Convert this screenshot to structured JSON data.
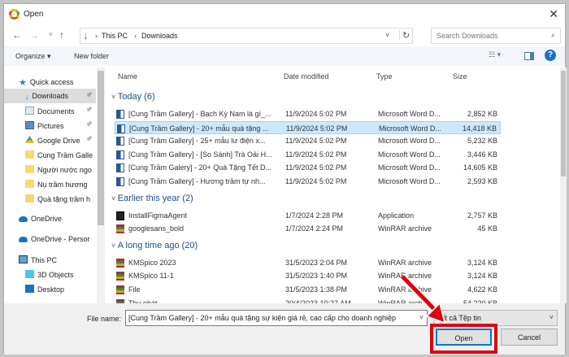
{
  "window": {
    "title": "Open"
  },
  "nav": {
    "path": [
      "This PC",
      "Downloads"
    ],
    "search_placeholder": "Search Downloads"
  },
  "toolbar": {
    "organize": "Organize ▾",
    "new_folder": "New folder"
  },
  "sidebar": {
    "items": [
      {
        "label": "Quick access",
        "icon": "star-icon",
        "indent": 0
      },
      {
        "label": "Downloads",
        "icon": "download-icon",
        "indent": 1,
        "selected": true,
        "pinned": true
      },
      {
        "label": "Documents",
        "icon": "document-icon",
        "indent": 1,
        "pinned": true
      },
      {
        "label": "Pictures",
        "icon": "pictures-icon",
        "indent": 1,
        "pinned": true
      },
      {
        "label": "Google Drive",
        "icon": "google-drive-icon",
        "indent": 1,
        "pinned": true
      },
      {
        "label": "Cung Trầm Galle",
        "icon": "folder-icon",
        "indent": 1
      },
      {
        "label": "Người nước ngo",
        "icon": "folder-icon",
        "indent": 1
      },
      {
        "label": "Nụ trầm hương",
        "icon": "folder-icon",
        "indent": 1
      },
      {
        "label": "Quà tặng trầm h",
        "icon": "folder-icon",
        "indent": 1
      },
      {
        "label": "OneDrive",
        "icon": "cloud-icon",
        "indent": 0
      },
      {
        "label": "OneDrive - Persor",
        "icon": "cloud-icon",
        "indent": 0
      },
      {
        "label": "This PC",
        "icon": "computer-icon",
        "indent": 0
      },
      {
        "label": "3D Objects",
        "icon": "cube-icon",
        "indent": 1
      },
      {
        "label": "Desktop",
        "icon": "desktop-icon",
        "indent": 1
      }
    ]
  },
  "columns": {
    "name": "Name",
    "date": "Date modified",
    "type": "Type",
    "size": "Size"
  },
  "groups": [
    {
      "label": "Today (6)",
      "files": [
        {
          "name": "[Cung Trầm Gallery] - Bạch Kỳ Nam là gì_...",
          "date": "11/9/2024 5:02 PM",
          "type": "Microsoft Word D...",
          "size": "2,852 KB",
          "icon": "word-icon"
        },
        {
          "name": "[Cung Trầm Gallery] - 20+ mẫu quà tặng ...",
          "date": "11/9/2024 5:02 PM",
          "type": "Microsoft Word D...",
          "size": "14,418 KB",
          "icon": "word-icon",
          "selected": true
        },
        {
          "name": "[Cung Trầm Gallery] - 25+ mẫu lư điện x...",
          "date": "11/9/2024 5:02 PM",
          "type": "Microsoft Word D...",
          "size": "5,232 KB",
          "icon": "word-icon"
        },
        {
          "name": "[Cung Trầm Gallery] - [So Sánh] Trà Oải H...",
          "date": "11/9/2024 5:02 PM",
          "type": "Microsoft Word D...",
          "size": "3,446 KB",
          "icon": "word-icon"
        },
        {
          "name": "[Cung Trầm Galery] - 20+ Quà Tặng Tết D...",
          "date": "11/9/2024 5:02 PM",
          "type": "Microsoft Word D...",
          "size": "14,605 KB",
          "icon": "word-icon"
        },
        {
          "name": "[Cung Trầm Gallery]  - Hương trầm tự nh...",
          "date": "11/9/2024 5:02 PM",
          "type": "Microsoft Word D...",
          "size": "2,593 KB",
          "icon": "word-icon"
        }
      ]
    },
    {
      "label": "Earlier this year (2)",
      "files": [
        {
          "name": "InstallFigmaAgent",
          "date": "1/7/2024 2:28 PM",
          "type": "Application",
          "size": "2,757 KB",
          "icon": "figma-icon"
        },
        {
          "name": "googlesans_bold",
          "date": "1/7/2024 2:24 PM",
          "type": "WinRAR archive",
          "size": "45 KB",
          "icon": "winrar-icon"
        }
      ]
    },
    {
      "label": "A long time ago (20)",
      "files": [
        {
          "name": "KMSpico 2023",
          "date": "31/5/2023 2:04 PM",
          "type": "WinRAR archive",
          "size": "3,124 KB",
          "icon": "winrar-icon"
        },
        {
          "name": "KMSpico 11-1",
          "date": "31/5/2023 1:40 PM",
          "type": "WinRAR archive",
          "size": "3,124 KB",
          "icon": "winrar-icon"
        },
        {
          "name": "File",
          "date": "31/5/2023 1:38 PM",
          "type": "WinRAR archive",
          "size": "4,622 KB",
          "icon": "winrar-icon"
        },
        {
          "name": "Thu phát",
          "date": "20/4/2023 10:27 AM",
          "type": "WinRAR archive",
          "size": "54,220 KB",
          "icon": "winrar-icon"
        }
      ]
    }
  ],
  "footer": {
    "file_name_label": "File name:",
    "file_name_value": "[Cung Trầm Gallery] - 20+ mẫu quà tặng sự kiện giá rẻ, cao cấp cho doanh nghiệp",
    "filter": "Tất cả Tệp tin",
    "open": "Open",
    "cancel": "Cancel"
  },
  "colors": {
    "highlight": "#e00010",
    "selection": "#cce8ff",
    "accent": "#0078d7"
  }
}
